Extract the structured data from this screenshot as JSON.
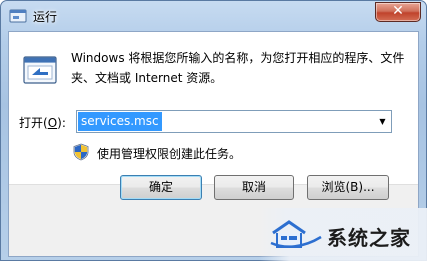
{
  "window": {
    "title": "运行",
    "close_glyph": "✕"
  },
  "dialog": {
    "description": "Windows 将根据您所输入的名称，为您打开相应的程序、文件夹、文档或 Internet 资源。",
    "open_label_prefix": "打开(",
    "open_label_key": "O",
    "open_label_suffix": "):",
    "input_value": "services.msc",
    "dropdown_glyph": "▼",
    "admin_note": "使用管理权限创建此任务。"
  },
  "buttons": {
    "ok_label": "确定",
    "cancel_label": "取消",
    "browse_label": "浏览(B)..."
  },
  "watermark": {
    "text": "系统之家"
  },
  "icons": {
    "title_icon": "run-app-icon",
    "main_icon": "run-window-icon",
    "shield": "uac-shield-icon",
    "watermark_logo": "house-logo-icon"
  },
  "colors": {
    "selection": "#3399ff",
    "titlebar": "#b6cfe9",
    "close_button": "#c0432c"
  }
}
